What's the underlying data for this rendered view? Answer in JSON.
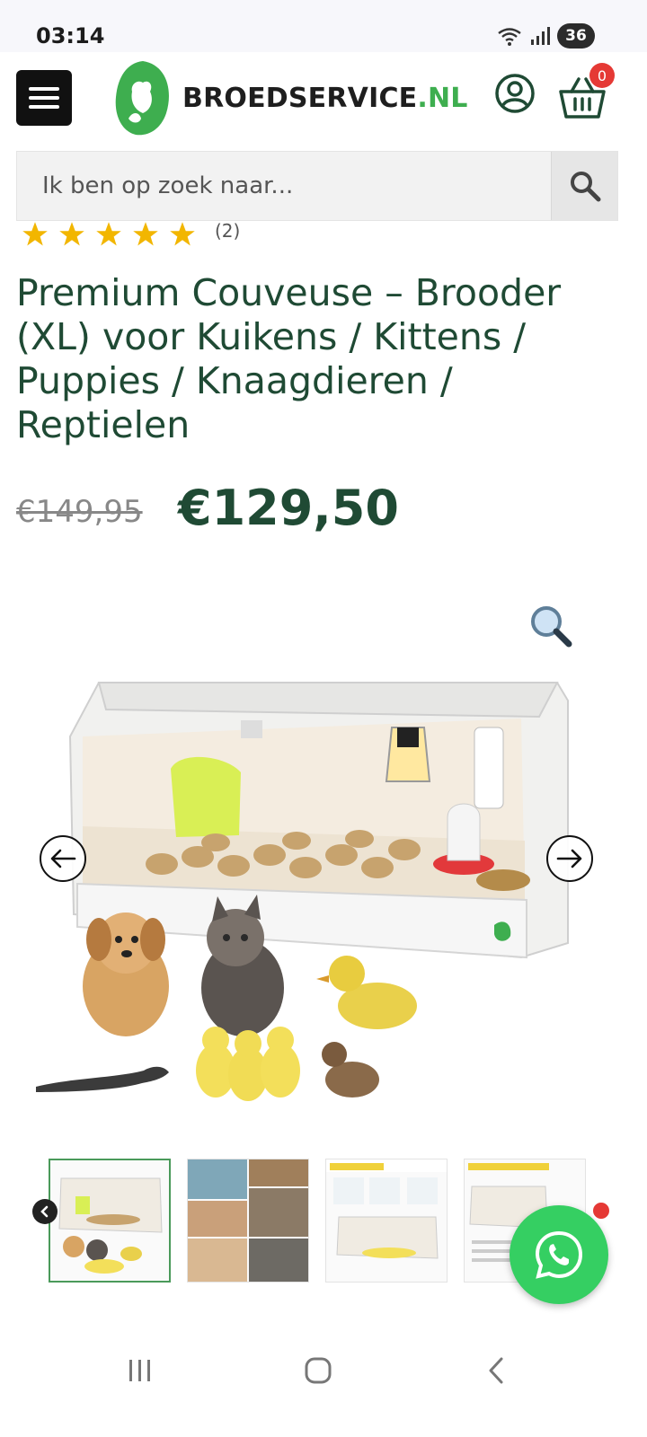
{
  "status_bar": {
    "time": "03:14",
    "battery_level": "36",
    "icons": [
      "wifi-icon",
      "signal-icon",
      "battery-icon"
    ]
  },
  "header": {
    "menu_icon": "hamburger-menu-icon",
    "logo_text_main": "BROEDSERVICE",
    "logo_text_tld": ".NL",
    "account_icon": "user-account-icon",
    "cart_icon": "shopping-basket-icon",
    "cart_count": "0",
    "brand_color": "#3eae4f"
  },
  "search": {
    "placeholder": "Ik ben op zoek naar...",
    "icon": "search-icon"
  },
  "product": {
    "rating_stars": 5,
    "rating_count": "(2)",
    "title": "Premium Couveuse – Brooder (XL) voor Kuikens / Kittens / Puppies / Knaagdieren / Reptielen",
    "price_old": "€149,95",
    "price_new": "€129,50",
    "text_color": "#1f4a34",
    "star_color": "#f2b600"
  },
  "gallery": {
    "zoom_icon": "magnifier-zoom-icon",
    "main_image": "brooder-with-animals-image",
    "prev_icon": "arrow-left-icon",
    "next_icon": "arrow-right-icon",
    "thumbnails": [
      {
        "name": "thumb-brooder-animals",
        "active": true
      },
      {
        "name": "thumb-brooder-collage",
        "active": false
      },
      {
        "name": "thumb-infographic-1",
        "active": false
      },
      {
        "name": "thumb-infographic-2",
        "active": false
      }
    ]
  },
  "whatsapp": {
    "icon": "whatsapp-icon",
    "color": "#35cf62"
  },
  "nav_bar": {
    "recents_icon": "recents-icon",
    "home_icon": "home-icon",
    "back_icon": "back-icon"
  }
}
